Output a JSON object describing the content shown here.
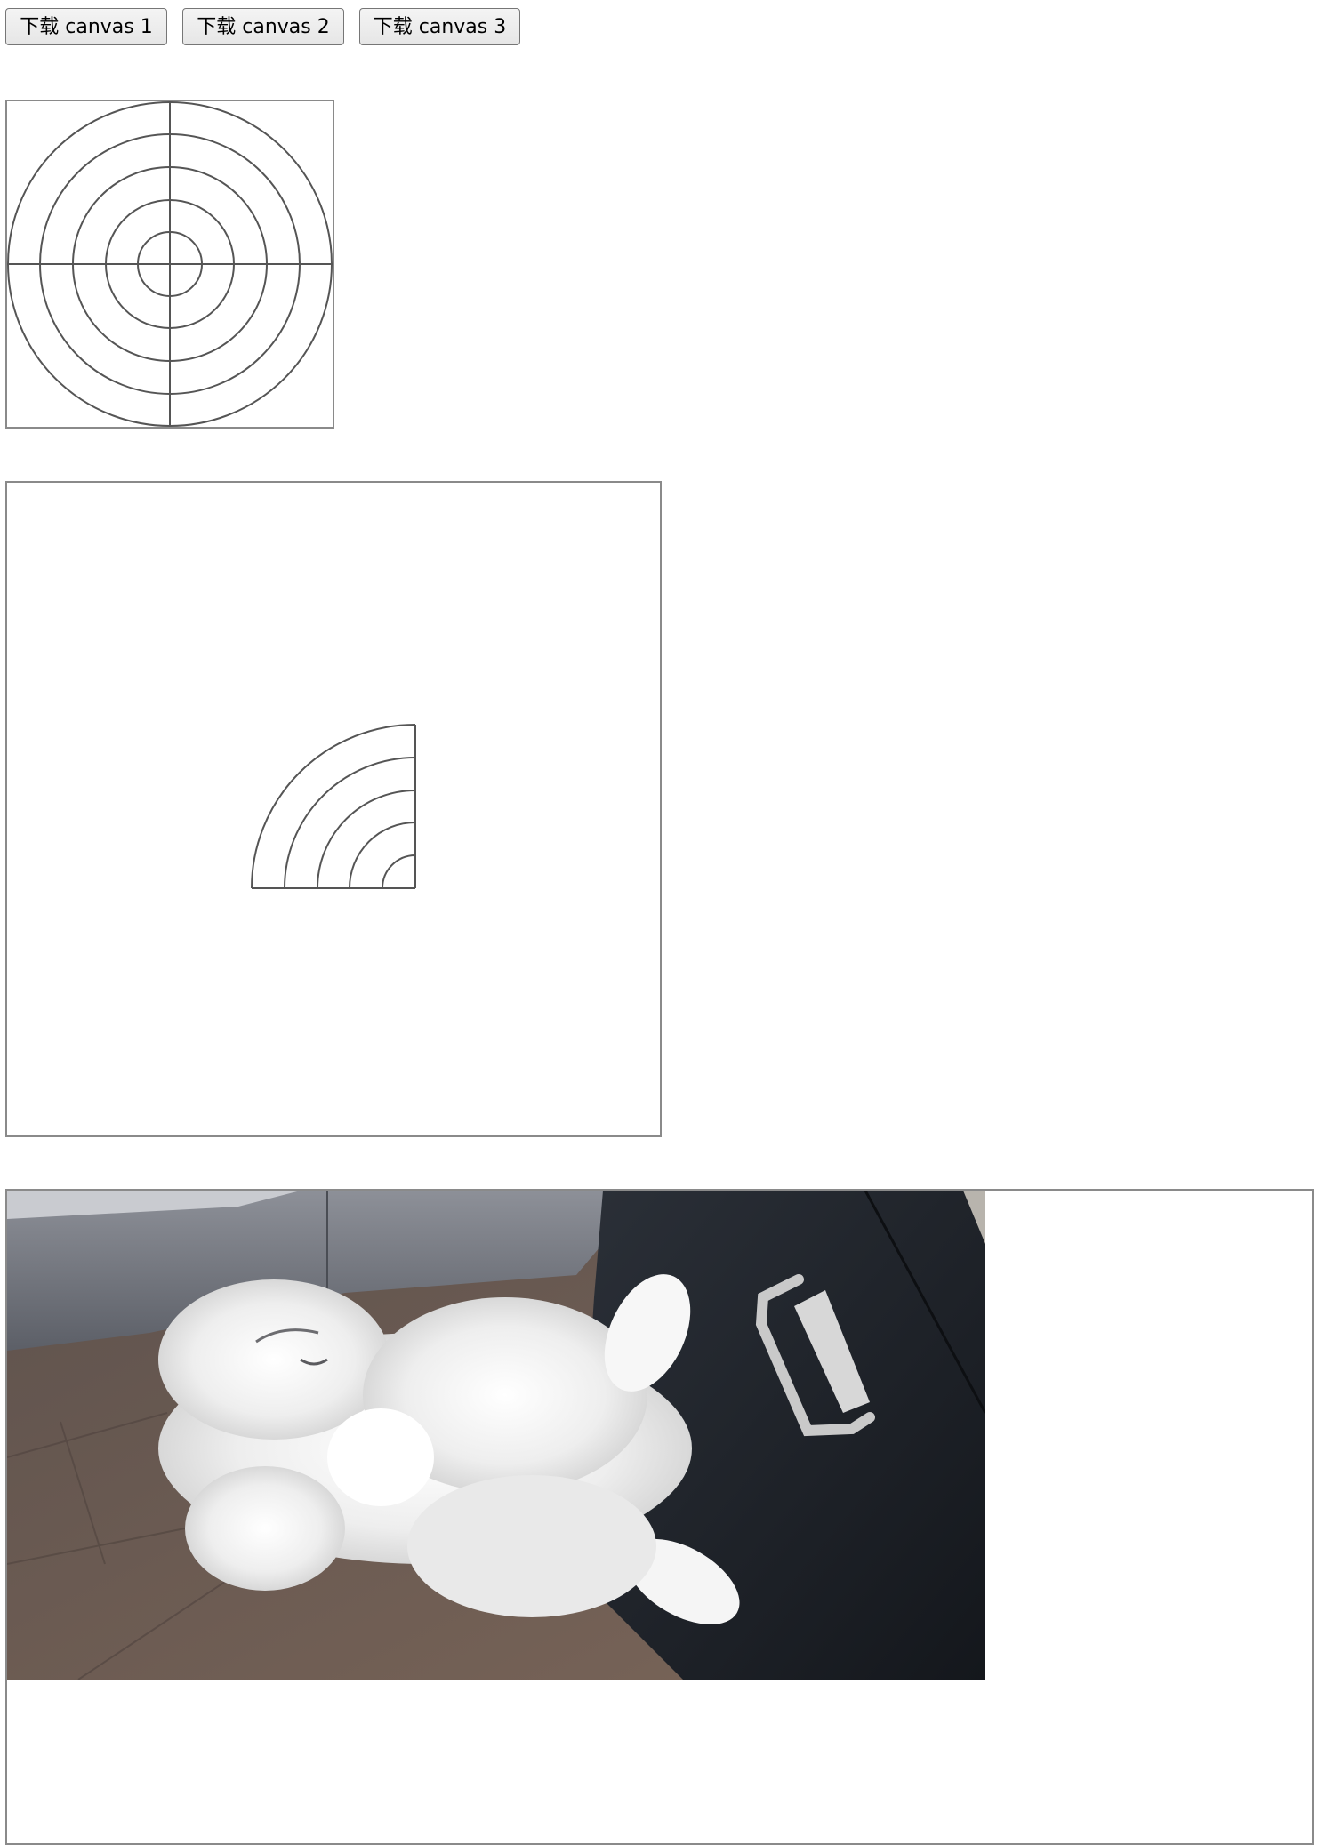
{
  "toolbar": {
    "buttons": [
      {
        "label": "下载 canvas 1"
      },
      {
        "label": "下载 canvas 2"
      },
      {
        "label": "下载 canvas 3"
      }
    ]
  },
  "canvas3": {
    "image_subject": "white fluffy cat lying on its back on a wooden floor next to a dark drawer with a metal handle"
  },
  "colors": {
    "canvas_border": "#8a8a8a",
    "stroke": "#555555",
    "floor": "#6d5a4f",
    "drawer": "#1f242c",
    "cat_fur": "#f2f2f2"
  }
}
